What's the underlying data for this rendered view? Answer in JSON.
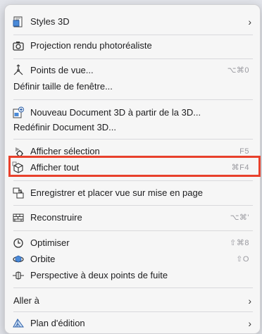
{
  "menu": {
    "items": [
      {
        "label": "Styles 3D",
        "icon": "styles-3d-icon",
        "submenu": true
      },
      {
        "label": "Projection rendu photoréaliste",
        "icon": "camera-icon"
      },
      {
        "label": "Points de vue...",
        "icon": "viewpoints-icon",
        "shortcut": "⌥⌘0"
      },
      {
        "label": "Définir taille de fenêtre..."
      },
      {
        "label": "Nouveau Document 3D à partir de la 3D...",
        "icon": "new-3d-document-icon"
      },
      {
        "label": "Redéfinir Document 3D..."
      },
      {
        "label": "Afficher sélection",
        "icon": "show-selection-icon",
        "shortcut": "F5"
      },
      {
        "label": "Afficher tout",
        "icon": "show-all-icon",
        "shortcut": "⌘F4"
      },
      {
        "label": "Enregistrer et placer vue sur mise en page",
        "icon": "save-place-view-icon"
      },
      {
        "label": "Reconstruire",
        "icon": "rebuild-icon",
        "shortcut": "⌥⌘'"
      },
      {
        "label": "Optimiser",
        "icon": "optimize-icon",
        "shortcut": "⇧⌘8"
      },
      {
        "label": "Orbite",
        "icon": "orbit-icon",
        "shortcut": "⇧O"
      },
      {
        "label": "Perspective à deux points de fuite",
        "icon": "two-point-perspective-icon"
      },
      {
        "label": "Aller à",
        "submenu": true
      },
      {
        "label": "Plan d'édition",
        "icon": "editing-plane-icon",
        "submenu": true
      }
    ],
    "submenu_glyph": "›"
  },
  "colors": {
    "highlight_border": "#e8412c",
    "menu_bg": "#f6f6f6"
  }
}
